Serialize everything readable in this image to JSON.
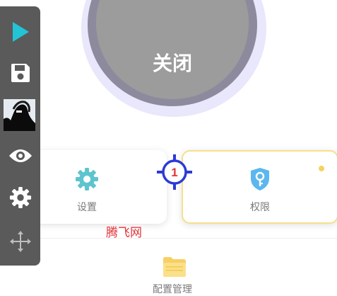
{
  "main_button": {
    "label": "关闭"
  },
  "cards": {
    "settings": {
      "label": "设置",
      "icon": "gear-icon",
      "color": "#5ec4cf"
    },
    "permissions": {
      "label": "权限",
      "icon": "key-shield-icon",
      "color": "#5bb7ee",
      "badge_color": "#f6d35e"
    }
  },
  "bottom": {
    "label": "配置管理",
    "icon": "folder-icon"
  },
  "toolbar": {
    "items": [
      "play-icon",
      "save-icon",
      "thumbnail-image",
      "eye-icon",
      "gear-icon",
      "move-icon"
    ],
    "play_color": "#22c4d6"
  },
  "marker": {
    "number": "1",
    "color": "#2b3ad6"
  },
  "watermark": {
    "text": "腾飞网"
  }
}
